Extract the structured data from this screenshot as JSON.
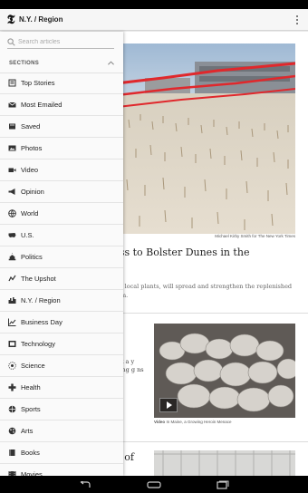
{
  "app": {
    "title": "N.Y. / Region",
    "logo_glyph": "𝕿",
    "overflow_icon": "overflow-menu-icon"
  },
  "drawer": {
    "search_placeholder": "Search articles",
    "sections_label": "SECTIONS",
    "items": [
      {
        "label": "Top Stories",
        "icon": "top-stories-icon"
      },
      {
        "label": "Most Emailed",
        "icon": "mail-icon"
      },
      {
        "label": "Saved",
        "icon": "saved-icon"
      },
      {
        "label": "Photos",
        "icon": "photo-icon"
      },
      {
        "label": "Video",
        "icon": "video-icon"
      },
      {
        "label": "Opinion",
        "icon": "megaphone-icon"
      },
      {
        "label": "World",
        "icon": "globe-icon"
      },
      {
        "label": "U.S.",
        "icon": "us-map-icon"
      },
      {
        "label": "Politics",
        "icon": "capitol-icon"
      },
      {
        "label": "The Upshot",
        "icon": "upshot-icon"
      },
      {
        "label": "N.Y. / Region",
        "icon": "ny-region-icon"
      },
      {
        "label": "Business Day",
        "icon": "business-chart-icon"
      },
      {
        "label": "Technology",
        "icon": "technology-icon"
      },
      {
        "label": "Science",
        "icon": "science-icon"
      },
      {
        "label": "Health",
        "icon": "health-cross-icon"
      },
      {
        "label": "Sports",
        "icon": "sports-ball-icon"
      },
      {
        "label": "Arts",
        "icon": "arts-palette-icon"
      },
      {
        "label": "Books",
        "icon": "book-icon"
      },
      {
        "label": "Movies",
        "icon": "movies-icon"
      }
    ]
  },
  "article": {
    "photo_credit": "Michael Kirby Smith for The New York Times",
    "headline": "rass to Bolster Dunes in the",
    "summary": "from local plants, will spread and strengthen the replenished storm.",
    "story2_excerpt": "meet a y setting g ns say.",
    "video_caption_label": "Video",
    "video_caption": "In Maine, a Growing Heroin Menace",
    "story3_headline": "on of"
  },
  "colors": {
    "drawer_bg": "#fafafa",
    "app_bar_bg": "#f6f6f6",
    "status_bar": "#000000"
  }
}
